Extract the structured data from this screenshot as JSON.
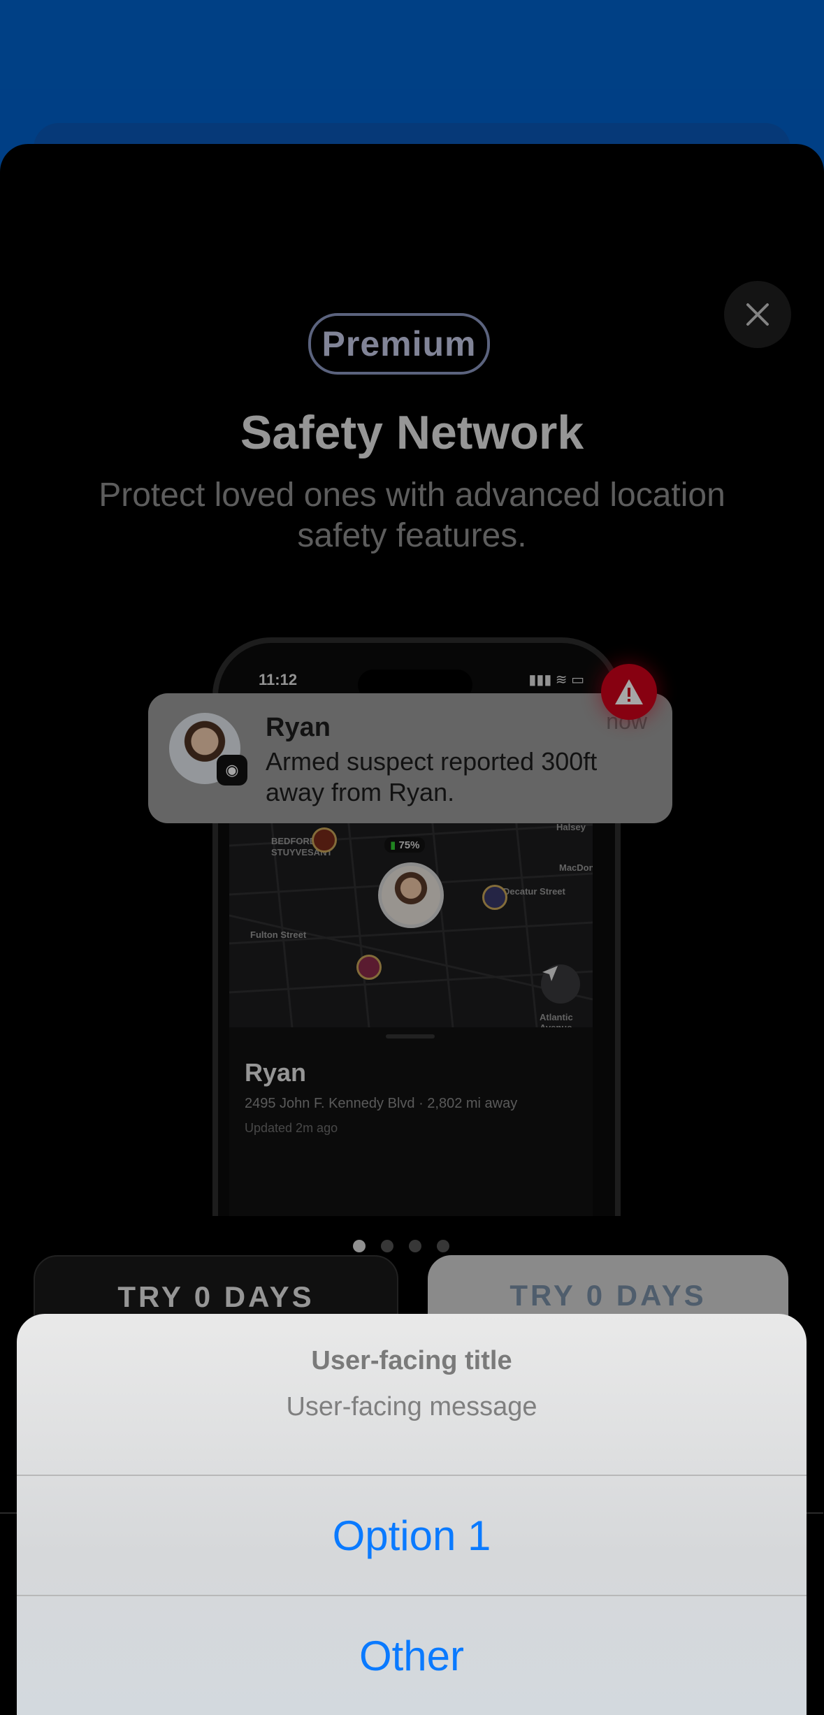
{
  "paywall": {
    "badge": "Premium",
    "title": "Safety Network",
    "subtitle": "Protect loved ones with advanced location safety features.",
    "close_icon": "close-icon",
    "phone": {
      "time": "11:12",
      "status": "▮▮▮ ≋ ▭",
      "battery": "75%",
      "map_labels": [
        "BEDFORD-\nSTUYVESANT",
        "Fulton Street",
        "Decatur Street",
        "MacDon",
        "Halsey",
        "Atlantic Avenue"
      ],
      "person_name": "Ryan",
      "address": "2495 John F. Kennedy Blvd · 2,802 mi away",
      "updated": "Updated 2m ago"
    },
    "notification": {
      "name": "Ryan",
      "time": "now",
      "message": "Armed suspect reported 300ft away from Ryan.",
      "app_icon": "broadcast-icon",
      "alert_icon": "warning-icon"
    },
    "plans": {
      "left_label": "TRY 0 DAYS",
      "right_label": "TRY 0 DAYS"
    }
  },
  "action_sheet": {
    "title": "User-facing title",
    "message": "User-facing message",
    "option1": "Option 1",
    "option2": "Other"
  },
  "colors": {
    "accent_blue": "#0a7aff",
    "background_blue": "#0062cc",
    "alert_red": "#d0021b"
  }
}
